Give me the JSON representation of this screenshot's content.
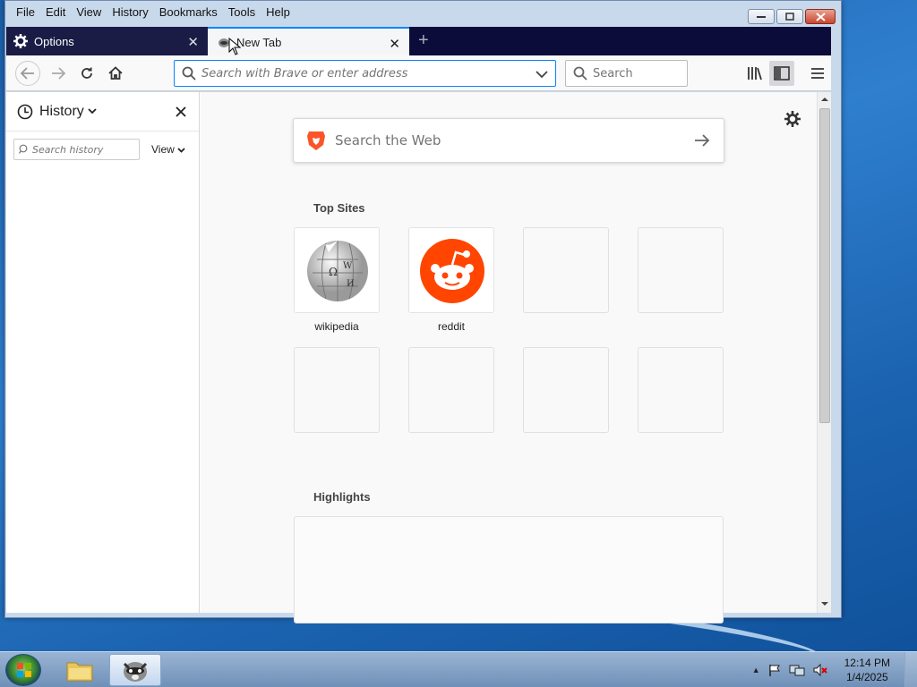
{
  "menubar": {
    "items": [
      {
        "label": "File",
        "key": "F"
      },
      {
        "label": "Edit",
        "key": "E"
      },
      {
        "label": "View",
        "key": "V"
      },
      {
        "label": "History",
        "key": "s"
      },
      {
        "label": "Bookmarks",
        "key": "B"
      },
      {
        "label": "Tools",
        "key": "T"
      },
      {
        "label": "Help",
        "key": "H"
      }
    ]
  },
  "tabs": [
    {
      "label": "Options",
      "icon": "gear-icon",
      "active": false
    },
    {
      "label": "New Tab",
      "icon": "brave-raccoon-icon",
      "active": true
    }
  ],
  "navbar": {
    "url_placeholder": "Search with Brave or enter address",
    "search_placeholder": "Search"
  },
  "sidebar": {
    "title": "History",
    "search_placeholder": "Search history",
    "view_label": "View"
  },
  "newtab": {
    "web_search_placeholder": "Search the Web",
    "top_sites_title": "Top Sites",
    "top_sites": [
      {
        "label": "wikipedia",
        "icon": "wikipedia-globe-icon"
      },
      {
        "label": "reddit",
        "icon": "reddit-alien-icon"
      },
      {
        "label": "",
        "icon": ""
      },
      {
        "label": "",
        "icon": ""
      },
      {
        "label": "",
        "icon": ""
      },
      {
        "label": "",
        "icon": ""
      },
      {
        "label": "",
        "icon": ""
      },
      {
        "label": "",
        "icon": ""
      }
    ],
    "highlights_title": "Highlights"
  },
  "taskbar": {
    "time": "12:14 PM",
    "date": "1/4/2025"
  },
  "colors": {
    "accent": "#0a84ff",
    "tab_dark": "#1a1c45",
    "reddit": "#ff4500",
    "brave": "#fb542b"
  }
}
